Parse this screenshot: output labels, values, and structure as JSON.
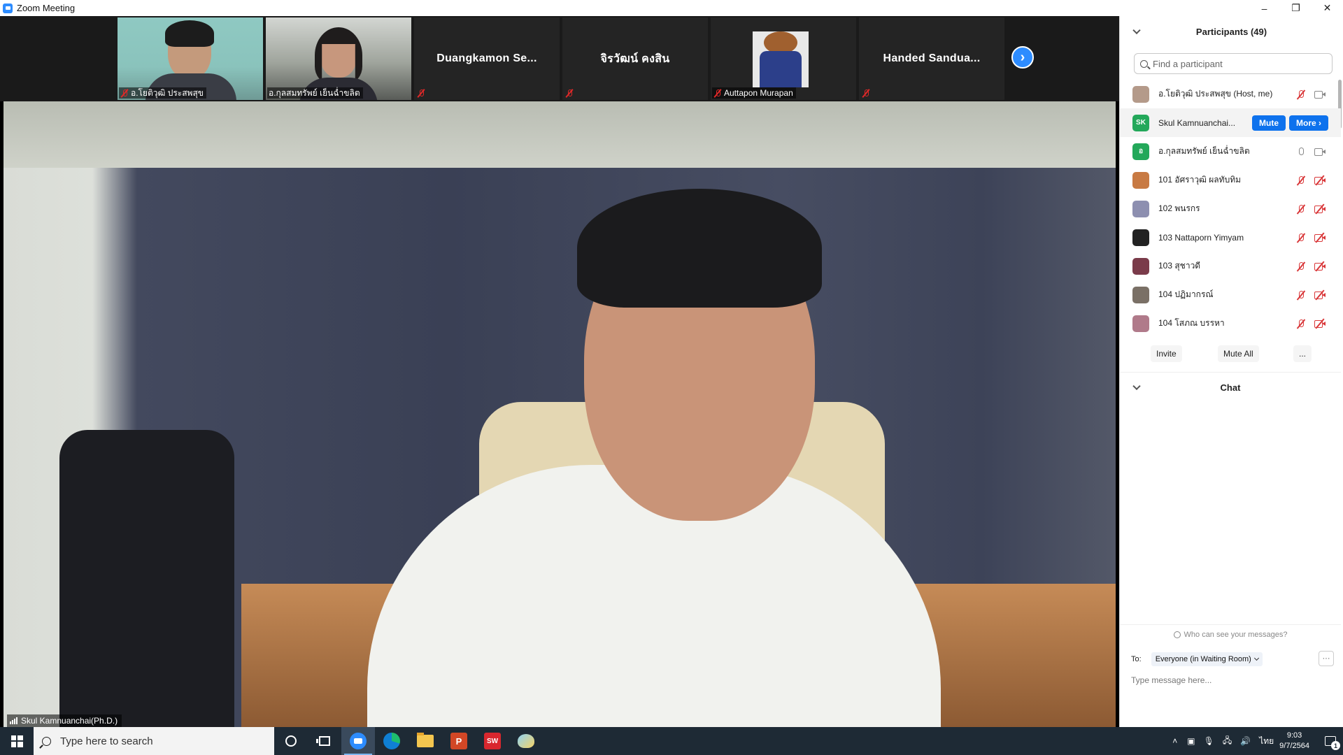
{
  "window": {
    "title": "Zoom Meeting",
    "minimize": "–",
    "restore": "❐",
    "close": "✕"
  },
  "colors": {
    "accent": "#0e72ed",
    "zoom_blue": "#2d8cff",
    "muted_red": "#d9383a",
    "taskbar": "#1e2a35"
  },
  "thumbnails": [
    {
      "label": "อ.โยติวุฒิ ประสพสุข",
      "muted": true,
      "has_video": true
    },
    {
      "label": "อ.กุลสมทรัพย์ เย็นฉ่ำขลิต",
      "muted": true,
      "has_video": true
    },
    {
      "name": "Duangkamon  Se...",
      "muted": true,
      "has_video": false
    },
    {
      "name": "จิรวัฒน์ คงสิน",
      "muted": true,
      "has_video": false
    },
    {
      "label": "Auttapon Murapan",
      "muted": true,
      "has_video": false,
      "avatar": "bear-avatar"
    },
    {
      "name": "Handed  Sandua...",
      "muted": true,
      "has_video": false
    }
  ],
  "thumbnail_next": "›",
  "speaker": {
    "label": "Skul Kamnuanchai(Ph.D.)"
  },
  "participants_panel": {
    "title": "Participants (49)",
    "search_placeholder": "Find a participant",
    "items": [
      {
        "name": "อ.โยติวุฒิ ประสพสุข (Host, me)",
        "avatar_color": "#b49a8a",
        "mic": "muted",
        "cam": "on"
      },
      {
        "name": "Skul Kamnuanchai...",
        "avatar_text": "SK",
        "avatar_color": "#23a85a",
        "mute_label": "Mute",
        "more_label": "More ›"
      },
      {
        "name": "อ.กุลสมทรัพย์ เย็นฉ่ำขลิต",
        "avatar_text": "อ",
        "avatar_color": "#23a85a",
        "mic": "on",
        "cam": "on"
      },
      {
        "name": "101 อัศราวุฒิ ผลทับทิม",
        "avatar_color": "#c87a43",
        "mic": "muted",
        "cam": "off"
      },
      {
        "name": "102 พนรกร",
        "avatar_color": "#8d8fb0",
        "mic": "muted",
        "cam": "off"
      },
      {
        "name": "103 Nattaporn Yimyam",
        "avatar_color": "#222222",
        "mic": "muted",
        "cam": "off"
      },
      {
        "name": "103 สุชาวดี",
        "avatar_color": "#7a3b4a",
        "mic": "muted",
        "cam": "off"
      },
      {
        "name": "104 ปฏิมากรณ์",
        "avatar_color": "#7a7066",
        "mic": "muted",
        "cam": "off"
      },
      {
        "name": "104 โสภณ บรรหา",
        "avatar_color": "#b07a8a",
        "mic": "muted",
        "cam": "off"
      }
    ],
    "invite_label": "Invite",
    "mute_all_label": "Mute All",
    "more_label": "..."
  },
  "chat_panel": {
    "title": "Chat",
    "who_can_see": "Who can see your messages?",
    "to_label": "To:",
    "to_value": "Everyone (in Waiting Room)",
    "more_label": "···",
    "input_placeholder": "Type message here..."
  },
  "taskbar": {
    "search_placeholder": "Type here to search",
    "apps": [
      "cortana-circle-icon",
      "task-view-icon",
      "zoom-icon",
      "edge-icon",
      "file-explorer-icon",
      "powerpoint-icon",
      "solidworks-icon",
      "paint-icon"
    ],
    "language": "ไทย",
    "time": "9:03",
    "date": "9/7/2564",
    "notifications": "1"
  }
}
